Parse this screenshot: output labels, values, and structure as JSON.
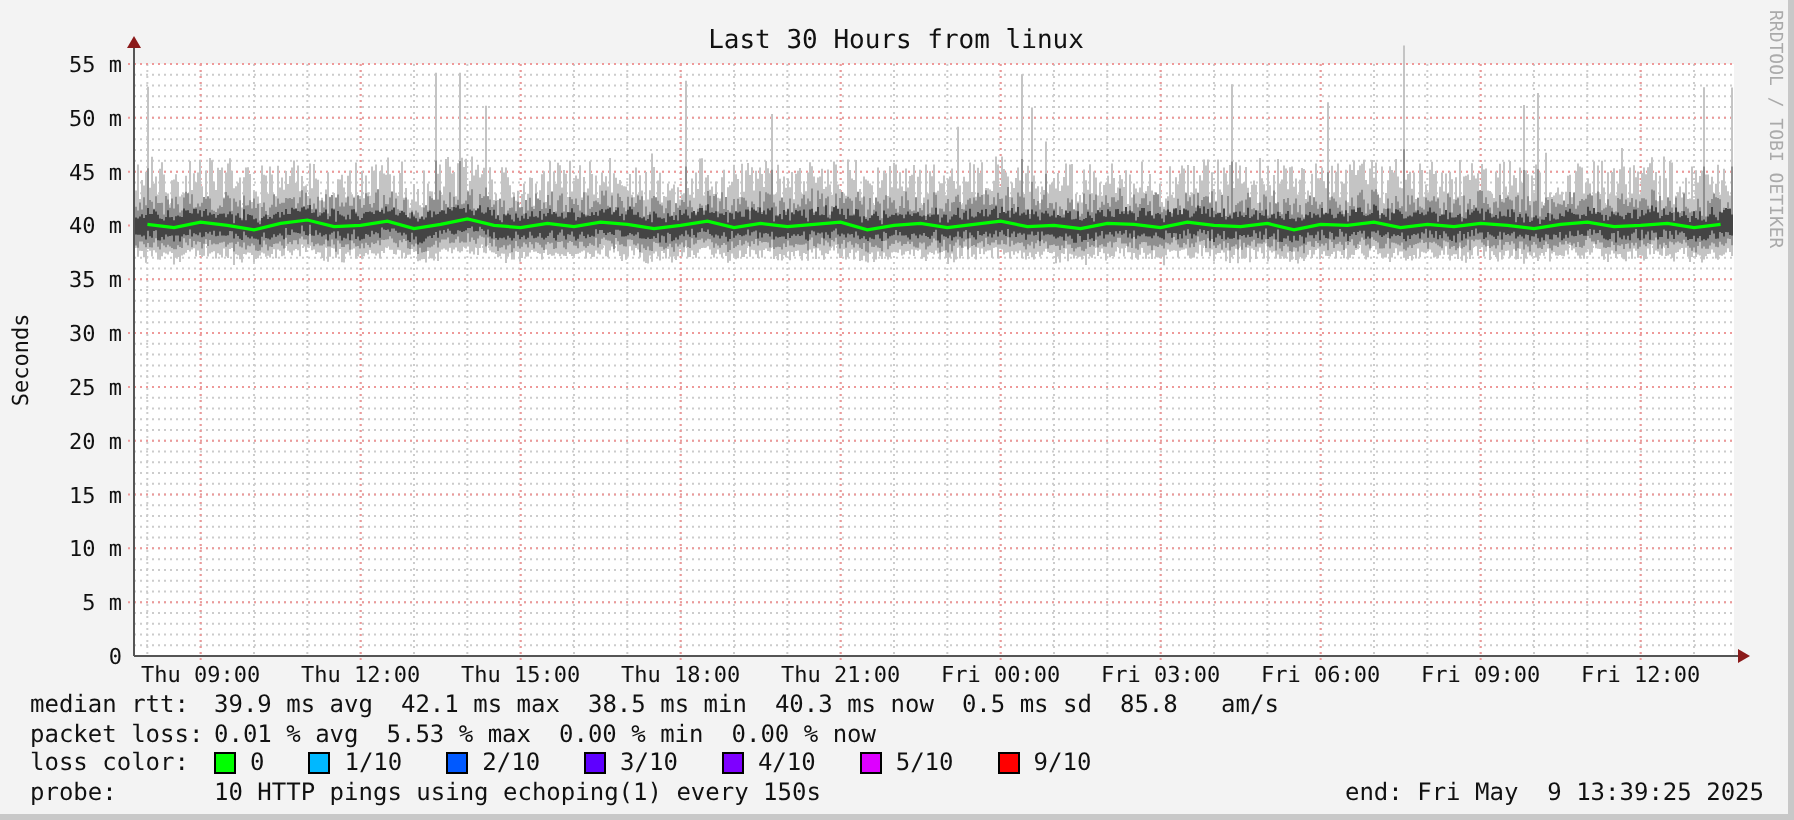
{
  "chart": {
    "credit": "RRDTOOL / TOBI OETIKER",
    "chart_data": {
      "type": "line",
      "title": "Last 30 Hours from linux",
      "ylabel": "Seconds",
      "categories": [
        null,
        null,
        "Thu 09:00",
        null,
        null,
        null,
        null,
        null,
        "Thu 12:00",
        null,
        null,
        null,
        null,
        null,
        "Thu 15:00",
        null,
        null,
        null,
        null,
        null,
        "Thu 18:00",
        null,
        null,
        null,
        null,
        null,
        "Thu 21:00",
        null,
        null,
        null,
        null,
        null,
        "Fri 00:00",
        null,
        null,
        null,
        null,
        null,
        "Fri 03:00",
        null,
        null,
        null,
        null,
        null,
        "Fri 06:00",
        null,
        null,
        null,
        null,
        null,
        "Fri 09:00",
        null,
        null,
        null,
        null,
        null,
        "Fri 12:00",
        null,
        null,
        null
      ],
      "series": [
        {
          "color": "#00ff00",
          "values": [
            40.1,
            39.8,
            40.3,
            40.0,
            39.6,
            40.2,
            40.5,
            39.9,
            40.0,
            40.4,
            39.7,
            40.1,
            40.6,
            40.0,
            39.8,
            40.2,
            39.9,
            40.3,
            40.1,
            39.7,
            40.0,
            40.4,
            39.8,
            40.2,
            39.9,
            40.1,
            40.3,
            39.6,
            40.0,
            40.2,
            39.8,
            40.1,
            40.4,
            39.9,
            40.0,
            39.7,
            40.2,
            40.1,
            39.8,
            40.3,
            40.0,
            39.9,
            40.2,
            39.6,
            40.1,
            40.0,
            40.3,
            39.8,
            40.1,
            39.9,
            40.2,
            40.0,
            39.7,
            40.1,
            40.3,
            39.9,
            40.0,
            40.2,
            39.8,
            40.1
          ]
        }
      ],
      "ylim": [
        0,
        55
      ],
      "grid": true,
      "yticks": [
        {
          "value": 0,
          "label": "0"
        },
        {
          "value": 5,
          "label": "5 m"
        },
        {
          "value": 10,
          "label": "10 m"
        },
        {
          "value": 15,
          "label": "15 m"
        },
        {
          "value": 20,
          "label": "20 m"
        },
        {
          "value": 25,
          "label": "25 m"
        },
        {
          "value": 30,
          "label": "30 m"
        },
        {
          "value": 35,
          "label": "35 m"
        },
        {
          "value": 40,
          "label": "40 m"
        },
        {
          "value": 45,
          "label": "45 m"
        },
        {
          "value": 50,
          "label": "50 m"
        },
        {
          "value": 55,
          "label": "55 m"
        }
      ]
    }
  },
  "legend": {
    "median_rtt": {
      "label": "median rtt:",
      "values": [
        "39.9 ms avg",
        "42.1 ms max",
        "38.5 ms min",
        "40.3 ms now",
        "0.5 ms sd",
        "85.8   am/s"
      ]
    },
    "packet_loss": {
      "label": "packet loss:",
      "values": [
        "0.01 % avg",
        "5.53 % max",
        "0.00 % min",
        "0.00 % now"
      ]
    },
    "loss_color": {
      "label": "loss color:",
      "items": [
        {
          "label": "0",
          "color": "#00ff00"
        },
        {
          "label": "1/10",
          "color": "#00b8ff"
        },
        {
          "label": "2/10",
          "color": "#0059ff"
        },
        {
          "label": "3/10",
          "color": "#5e00ff"
        },
        {
          "label": "4/10",
          "color": "#7e00ff"
        },
        {
          "label": "5/10",
          "color": "#dd00ff"
        },
        {
          "label": "9/10",
          "color": "#ff0000"
        }
      ]
    },
    "probe": {
      "label": "probe:",
      "text": "10 HTTP pings using echoping(1) every 150s"
    },
    "end": "end: Fri May  9 13:39:25 2025"
  }
}
